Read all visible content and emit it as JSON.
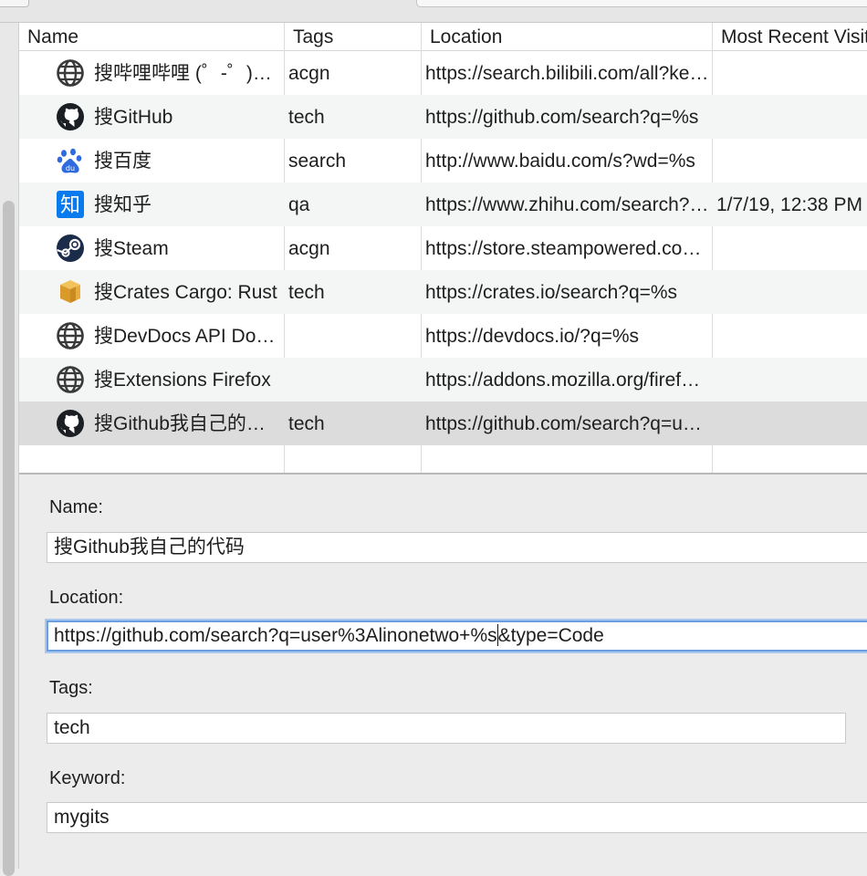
{
  "table": {
    "columns": {
      "name": "Name",
      "tags": "Tags",
      "location": "Location",
      "most_recent_visit": "Most Recent Visit"
    },
    "rows": [
      {
        "icon": "globe-icon",
        "name": "搜哔哩哔哩 (゜-゜)つロ 干杯~",
        "tags": "acgn",
        "location": "https://search.bilibili.com/all?keyword=%s",
        "visit": ""
      },
      {
        "icon": "github-icon",
        "name": "搜GitHub",
        "tags": "tech",
        "location": "https://github.com/search?q=%s",
        "visit": ""
      },
      {
        "icon": "baidu-icon",
        "name": "搜百度",
        "tags": "search",
        "location": "http://www.baidu.com/s?wd=%s",
        "visit": ""
      },
      {
        "icon": "zhihu-icon",
        "name": "搜知乎",
        "tags": "qa",
        "location": "https://www.zhihu.com/search?q=%s",
        "visit": "1/7/19, 12:38 PM"
      },
      {
        "icon": "steam-icon",
        "name": "搜Steam",
        "tags": "acgn",
        "location": "https://store.steampowered.com/search/?term=%s",
        "visit": ""
      },
      {
        "icon": "crates-icon",
        "name": "搜Crates Cargo: Rust",
        "tags": "tech",
        "location": "https://crates.io/search?q=%s",
        "visit": ""
      },
      {
        "icon": "globe-icon",
        "name": "搜DevDocs API Documentation",
        "tags": "",
        "location": "https://devdocs.io/?q=%s",
        "visit": ""
      },
      {
        "icon": "globe-icon",
        "name": "搜Extensions Firefox",
        "tags": "",
        "location": "https://addons.mozilla.org/firefox/search/?q=%s",
        "visit": ""
      },
      {
        "icon": "github-icon",
        "name": "搜Github我自己的代码",
        "tags": "tech",
        "location": "https://github.com/search?q=user%3Alinonetwo+%s&type=Code",
        "visit": "",
        "selected": true
      }
    ]
  },
  "details": {
    "name_label": "Name:",
    "name_value": "搜Github我自己的代码",
    "location_label": "Location:",
    "location_before_caret": "https://github.com/search?q=user%3Alinonetwo+%s",
    "location_after_caret": "&type=Code",
    "tags_label": "Tags:",
    "tags_value": "tech",
    "keyword_label": "Keyword:",
    "keyword_value": "mygits"
  }
}
